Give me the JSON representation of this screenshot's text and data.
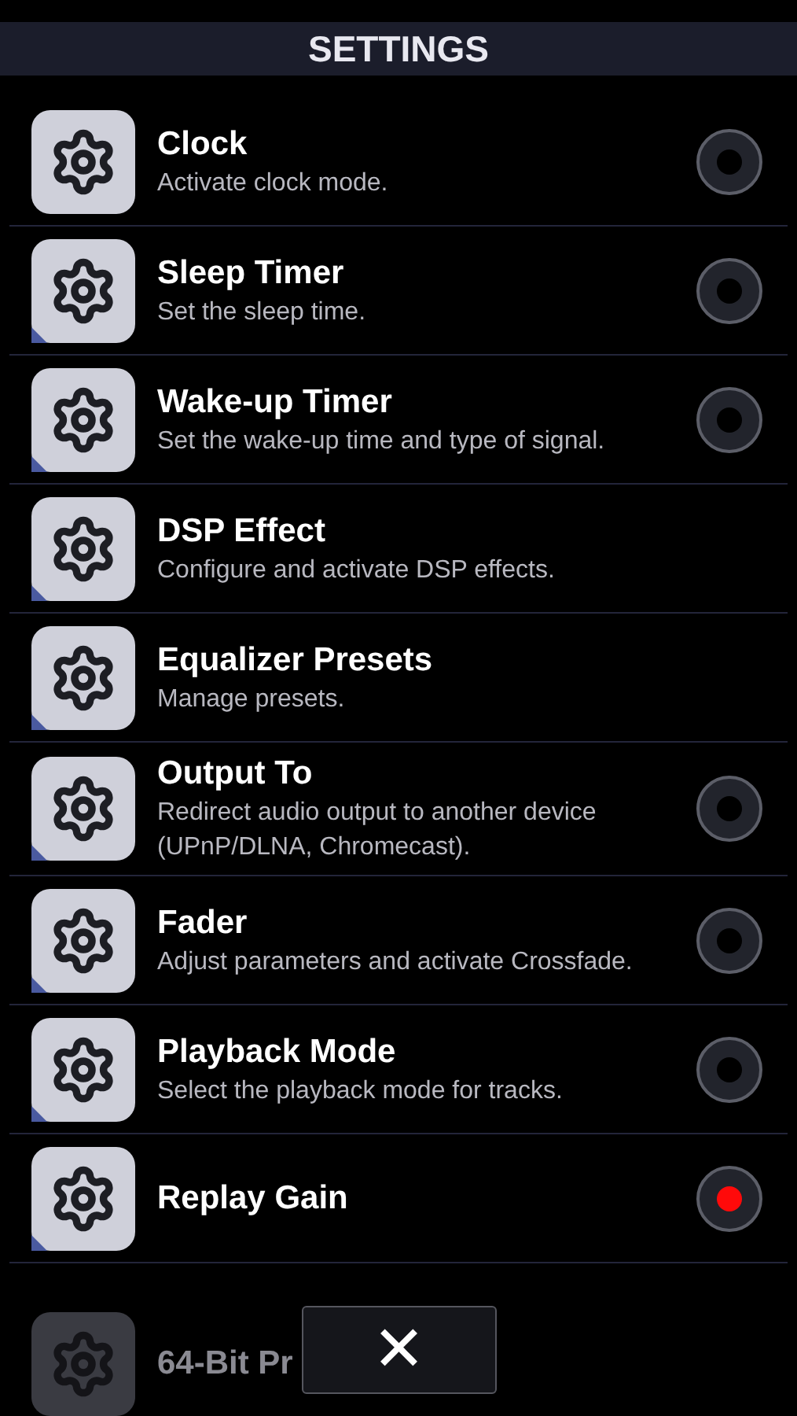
{
  "header": {
    "title": "SETTINGS"
  },
  "items": [
    {
      "title": "Clock",
      "subtitle": "Activate clock mode.",
      "kind": "toggle",
      "on": false,
      "submenu": false
    },
    {
      "title": "Sleep Timer",
      "subtitle": "Set the sleep time.",
      "kind": "toggle",
      "on": false,
      "submenu": true
    },
    {
      "title": "Wake-up Timer",
      "subtitle": "Set the wake-up time and type of signal.",
      "kind": "toggle",
      "on": false,
      "submenu": true
    },
    {
      "title": "DSP Effect",
      "subtitle": "Configure and activate DSP effects.",
      "kind": "plain",
      "submenu": true
    },
    {
      "title": "Equalizer Presets",
      "subtitle": "Manage presets.",
      "kind": "plain",
      "submenu": true
    },
    {
      "title": "Output To",
      "subtitle": "Redirect audio output to another device (UPnP/DLNA, Chromecast).",
      "kind": "toggle",
      "on": false,
      "submenu": true
    },
    {
      "title": "Fader",
      "subtitle": "Adjust parameters and activate Crossfade.",
      "kind": "toggle",
      "on": false,
      "submenu": true
    },
    {
      "title": "Playback Mode",
      "subtitle": "Select the playback mode for tracks.",
      "kind": "toggle",
      "on": false,
      "submenu": true
    },
    {
      "title": "Replay Gain",
      "kind": "toggle",
      "on": true,
      "submenu": true
    }
  ],
  "faded_item": {
    "title": "64-Bit Pr"
  },
  "close_button": {
    "label": "✕"
  }
}
